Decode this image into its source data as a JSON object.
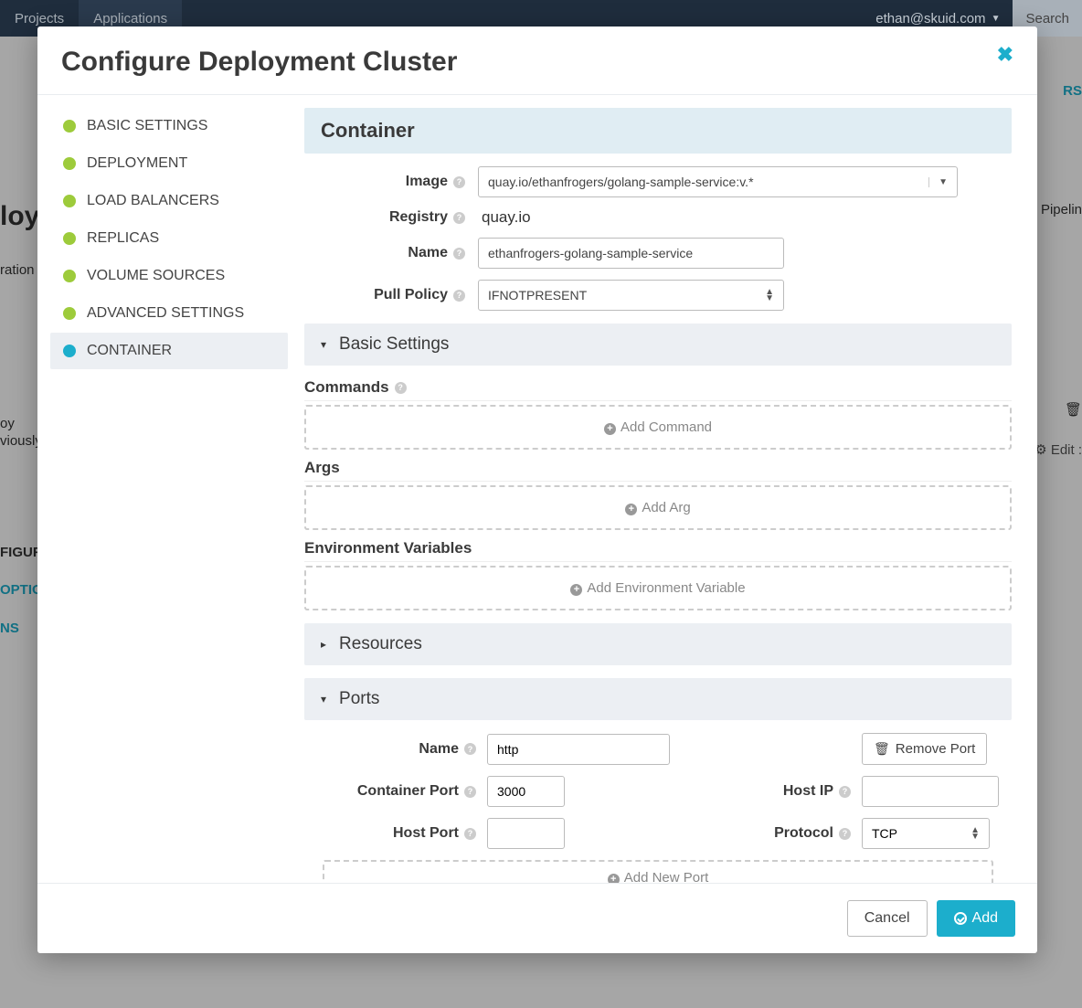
{
  "topnav": {
    "tab_projects": "Projects",
    "tab_applications": "Applications",
    "user": "ethan@skuid.com",
    "search": "Search"
  },
  "background": {
    "rs": "RS",
    "pipe": "Pipelin",
    "edit": "Edit :",
    "left_deploy": "loy",
    "left_ration": "ration",
    "left_oy": "oy",
    "left_vious": "viously",
    "left_figur": "FIGUR",
    "left_optio": "OPTIO",
    "left_ns": "NS"
  },
  "modal": {
    "title": "Configure Deployment Cluster",
    "sidebar": {
      "items": [
        {
          "label": "BASIC SETTINGS",
          "active": false
        },
        {
          "label": "DEPLOYMENT",
          "active": false
        },
        {
          "label": "LOAD BALANCERS",
          "active": false
        },
        {
          "label": "REPLICAS",
          "active": false
        },
        {
          "label": "VOLUME SOURCES",
          "active": false
        },
        {
          "label": "ADVANCED SETTINGS",
          "active": false
        },
        {
          "label": "CONTAINER",
          "active": true
        }
      ]
    },
    "container": {
      "heading": "Container",
      "labels": {
        "image": "Image",
        "registry": "Registry",
        "name": "Name",
        "pull_policy": "Pull Policy"
      },
      "image": "quay.io/ethanfrogers/golang-sample-service:v.*",
      "registry": "quay.io",
      "name": "ethanfrogers-golang-sample-service",
      "pull_policy": "IFNOTPRESENT"
    },
    "basic": {
      "heading": "Basic Settings",
      "commands_label": "Commands",
      "add_command": "Add Command",
      "args_label": "Args",
      "add_arg": "Add Arg",
      "env_label": "Environment Variables",
      "add_env": "Add Environment Variable"
    },
    "resources": {
      "heading": "Resources"
    },
    "ports": {
      "heading": "Ports",
      "labels": {
        "name": "Name",
        "container_port": "Container Port",
        "host_port": "Host Port",
        "host_ip": "Host IP",
        "protocol": "Protocol"
      },
      "remove_label": "Remove Port",
      "add_new": "Add New Port",
      "row": {
        "name": "http",
        "container_port": "3000",
        "host_port": "",
        "host_ip": "",
        "protocol": "TCP"
      }
    },
    "footer": {
      "cancel": "Cancel",
      "add": "Add"
    }
  }
}
